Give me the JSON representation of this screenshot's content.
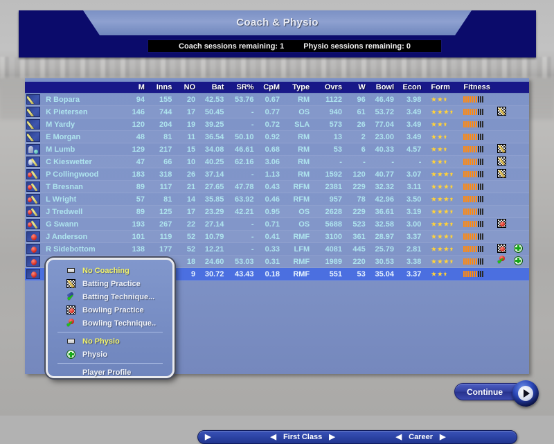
{
  "window": {
    "title": "Coach & Physio",
    "coach_sessions_label": "Coach sessions remaining: 1",
    "physio_sessions_label": "Physio sessions remaining: 0"
  },
  "colors": {
    "header_blue": "#181888",
    "panel_blue": "#7e93c8",
    "selection_blue": "#4b6fe0",
    "value_cyan": "#aee4ee",
    "star_gold": "#ffd23a",
    "fitness_orange": "#ff8a12",
    "title_navy": "#0b0b6b"
  },
  "table": {
    "columns": [
      "",
      "",
      "M",
      "Inns",
      "NO",
      "Bat",
      "SR%",
      "CpM",
      "Type",
      "Ovrs",
      "W",
      "Bowl",
      "Econ",
      "Form",
      "Fitness"
    ],
    "rows": [
      {
        "icon": "bat",
        "name": "R Bopara",
        "m": "94",
        "inns": "155",
        "no": "20",
        "bat": "42.53",
        "sr": "53.76",
        "cpm": "0.67",
        "type": "RM",
        "ovrs": "1122",
        "w": "96",
        "bowl": "46.49",
        "econ": "3.98",
        "form_full": 2,
        "form_half": true,
        "fitness": 7,
        "fitness_total": 10,
        "icon1": "",
        "icon2": "",
        "selected": false
      },
      {
        "icon": "bat",
        "name": "K Pietersen",
        "m": "146",
        "inns": "744",
        "no": "17",
        "bat": "50.45",
        "sr": "-",
        "cpm": "0.77",
        "type": "OS",
        "ovrs": "940",
        "w": "61",
        "bowl": "53.72",
        "econ": "3.49",
        "form_full": 3,
        "form_half": true,
        "fitness": 7,
        "fitness_total": 10,
        "icon1": "batting-practice",
        "icon2": "",
        "selected": false
      },
      {
        "icon": "bat",
        "name": "M Yardy",
        "m": "120",
        "inns": "204",
        "no": "19",
        "bat": "39.25",
        "sr": "-",
        "cpm": "0.72",
        "type": "SLA",
        "ovrs": "573",
        "w": "26",
        "bowl": "77.04",
        "econ": "3.49",
        "form_full": 2,
        "form_half": true,
        "fitness": 7,
        "fitness_total": 10,
        "icon1": "",
        "icon2": "",
        "selected": false
      },
      {
        "icon": "bat",
        "name": "E Morgan",
        "m": "48",
        "inns": "81",
        "no": "11",
        "bat": "36.54",
        "sr": "50.10",
        "cpm": "0.92",
        "type": "RM",
        "ovrs": "13",
        "w": "2",
        "bowl": "23.00",
        "econ": "3.49",
        "form_full": 2,
        "form_half": true,
        "fitness": 7,
        "fitness_total": 10,
        "icon1": "",
        "icon2": "",
        "selected": false
      },
      {
        "icon": "keeper",
        "name": "M Lumb",
        "m": "129",
        "inns": "217",
        "no": "15",
        "bat": "34.08",
        "sr": "46.61",
        "cpm": "0.68",
        "type": "RM",
        "ovrs": "53",
        "w": "6",
        "bowl": "40.33",
        "econ": "4.57",
        "form_full": 2,
        "form_half": true,
        "fitness": 7,
        "fitness_total": 10,
        "icon1": "batting-practice",
        "icon2": "",
        "selected": false
      },
      {
        "icon": "wk",
        "name": "C Kieswetter",
        "m": "47",
        "inns": "66",
        "no": "10",
        "bat": "40.25",
        "sr": "62.16",
        "cpm": "3.06",
        "type": "RM",
        "ovrs": "-",
        "w": "-",
        "bowl": "-",
        "econ": "-",
        "form_full": 2,
        "form_half": true,
        "fitness": 7,
        "fitness_total": 10,
        "icon1": "batting-practice",
        "icon2": "",
        "selected": false
      },
      {
        "icon": "allrounder",
        "name": "P Collingwood",
        "m": "183",
        "inns": "318",
        "no": "26",
        "bat": "37.14",
        "sr": "-",
        "cpm": "1.13",
        "type": "RM",
        "ovrs": "1592",
        "w": "120",
        "bowl": "40.77",
        "econ": "3.07",
        "form_full": 3,
        "form_half": true,
        "fitness": 7,
        "fitness_total": 10,
        "icon1": "batting-practice",
        "icon2": "",
        "selected": false
      },
      {
        "icon": "allrounder",
        "name": "T Bresnan",
        "m": "89",
        "inns": "117",
        "no": "21",
        "bat": "27.65",
        "sr": "47.78",
        "cpm": "0.43",
        "type": "RFM",
        "ovrs": "2381",
        "w": "229",
        "bowl": "32.32",
        "econ": "3.11",
        "form_full": 3,
        "form_half": true,
        "fitness": 7,
        "fitness_total": 10,
        "icon1": "",
        "icon2": "",
        "selected": false
      },
      {
        "icon": "allrounder",
        "name": "L Wright",
        "m": "57",
        "inns": "81",
        "no": "14",
        "bat": "35.85",
        "sr": "63.92",
        "cpm": "0.46",
        "type": "RFM",
        "ovrs": "957",
        "w": "78",
        "bowl": "42.96",
        "econ": "3.50",
        "form_full": 3,
        "form_half": true,
        "fitness": 7,
        "fitness_total": 10,
        "icon1": "",
        "icon2": "",
        "selected": false
      },
      {
        "icon": "allrounder",
        "name": "J Tredwell",
        "m": "89",
        "inns": "125",
        "no": "17",
        "bat": "23.29",
        "sr": "42.21",
        "cpm": "0.95",
        "type": "OS",
        "ovrs": "2628",
        "w": "229",
        "bowl": "36.61",
        "econ": "3.19",
        "form_full": 3,
        "form_half": true,
        "fitness": 7,
        "fitness_total": 10,
        "icon1": "",
        "icon2": "",
        "selected": false
      },
      {
        "icon": "allrounder",
        "name": "G Swann",
        "m": "193",
        "inns": "267",
        "no": "22",
        "bat": "27.14",
        "sr": "-",
        "cpm": "0.71",
        "type": "OS",
        "ovrs": "5688",
        "w": "523",
        "bowl": "32.58",
        "econ": "3.00",
        "form_full": 3,
        "form_half": true,
        "fitness": 7,
        "fitness_total": 10,
        "icon1": "bowling-practice",
        "icon2": "",
        "selected": false
      },
      {
        "icon": "ball",
        "name": "J Anderson",
        "m": "101",
        "inns": "119",
        "no": "52",
        "bat": "10.79",
        "sr": "-",
        "cpm": "0.41",
        "type": "RMF",
        "ovrs": "3100",
        "w": "361",
        "bowl": "28.97",
        "econ": "3.37",
        "form_full": 3,
        "form_half": true,
        "fitness": 7,
        "fitness_total": 10,
        "icon1": "",
        "icon2": "",
        "selected": false
      },
      {
        "icon": "ball",
        "name": "R Sidebottom",
        "m": "138",
        "inns": "177",
        "no": "52",
        "bat": "12.21",
        "sr": "-",
        "cpm": "0.33",
        "type": "LFM",
        "ovrs": "4081",
        "w": "445",
        "bowl": "25.79",
        "econ": "2.81",
        "form_full": 3,
        "form_half": true,
        "fitness": 7,
        "fitness_total": 10,
        "icon1": "bowling-practice",
        "icon2": "physio",
        "selected": false
      },
      {
        "icon": "ball",
        "name": "",
        "m": "",
        "inns": "",
        "no": "18",
        "bat": "24.60",
        "sr": "53.03",
        "cpm": "0.31",
        "type": "RMF",
        "ovrs": "1989",
        "w": "220",
        "bowl": "30.53",
        "econ": "3.38",
        "form_full": 3,
        "form_half": true,
        "fitness": 7,
        "fitness_total": 10,
        "icon1": "bowling-technique",
        "icon2": "physio",
        "selected": false
      },
      {
        "icon": "ball",
        "name": "",
        "m": "",
        "inns": "",
        "no": "9",
        "bat": "30.72",
        "sr": "43.43",
        "cpm": "0.18",
        "type": "RMF",
        "ovrs": "551",
        "w": "53",
        "bowl": "35.04",
        "econ": "3.37",
        "form_full": 2,
        "form_half": true,
        "fitness": 7,
        "fitness_total": 10,
        "icon1": "",
        "icon2": "",
        "selected": true
      }
    ]
  },
  "context_menu": {
    "items": [
      {
        "label": "No Coaching",
        "icon": "no-coaching-icon",
        "current": true,
        "separator_after": false
      },
      {
        "label": "Batting Practice",
        "icon": "batting-practice-icon",
        "current": false,
        "separator_after": false
      },
      {
        "label": "Batting Technique...",
        "icon": "batting-technique-icon",
        "current": false,
        "separator_after": false
      },
      {
        "label": "Bowling Practice",
        "icon": "bowling-practice-icon",
        "current": false,
        "separator_after": false
      },
      {
        "label": "Bowling Technique..",
        "icon": "bowling-technique-icon",
        "current": false,
        "separator_after": true
      },
      {
        "label": "No Physio",
        "icon": "no-physio-icon",
        "current": true,
        "separator_after": false
      },
      {
        "label": "Physio",
        "icon": "physio-icon",
        "current": false,
        "separator_after": true
      },
      {
        "label": "Player Profile",
        "icon": "",
        "current": false,
        "separator_after": false
      }
    ]
  },
  "footer": {
    "left_arrow_glyph": "▶",
    "prev_glyph": "◀",
    "next_glyph": "▶",
    "group1_label": "First Class",
    "group2_label": "Career"
  },
  "continue": {
    "label": "Continue"
  }
}
